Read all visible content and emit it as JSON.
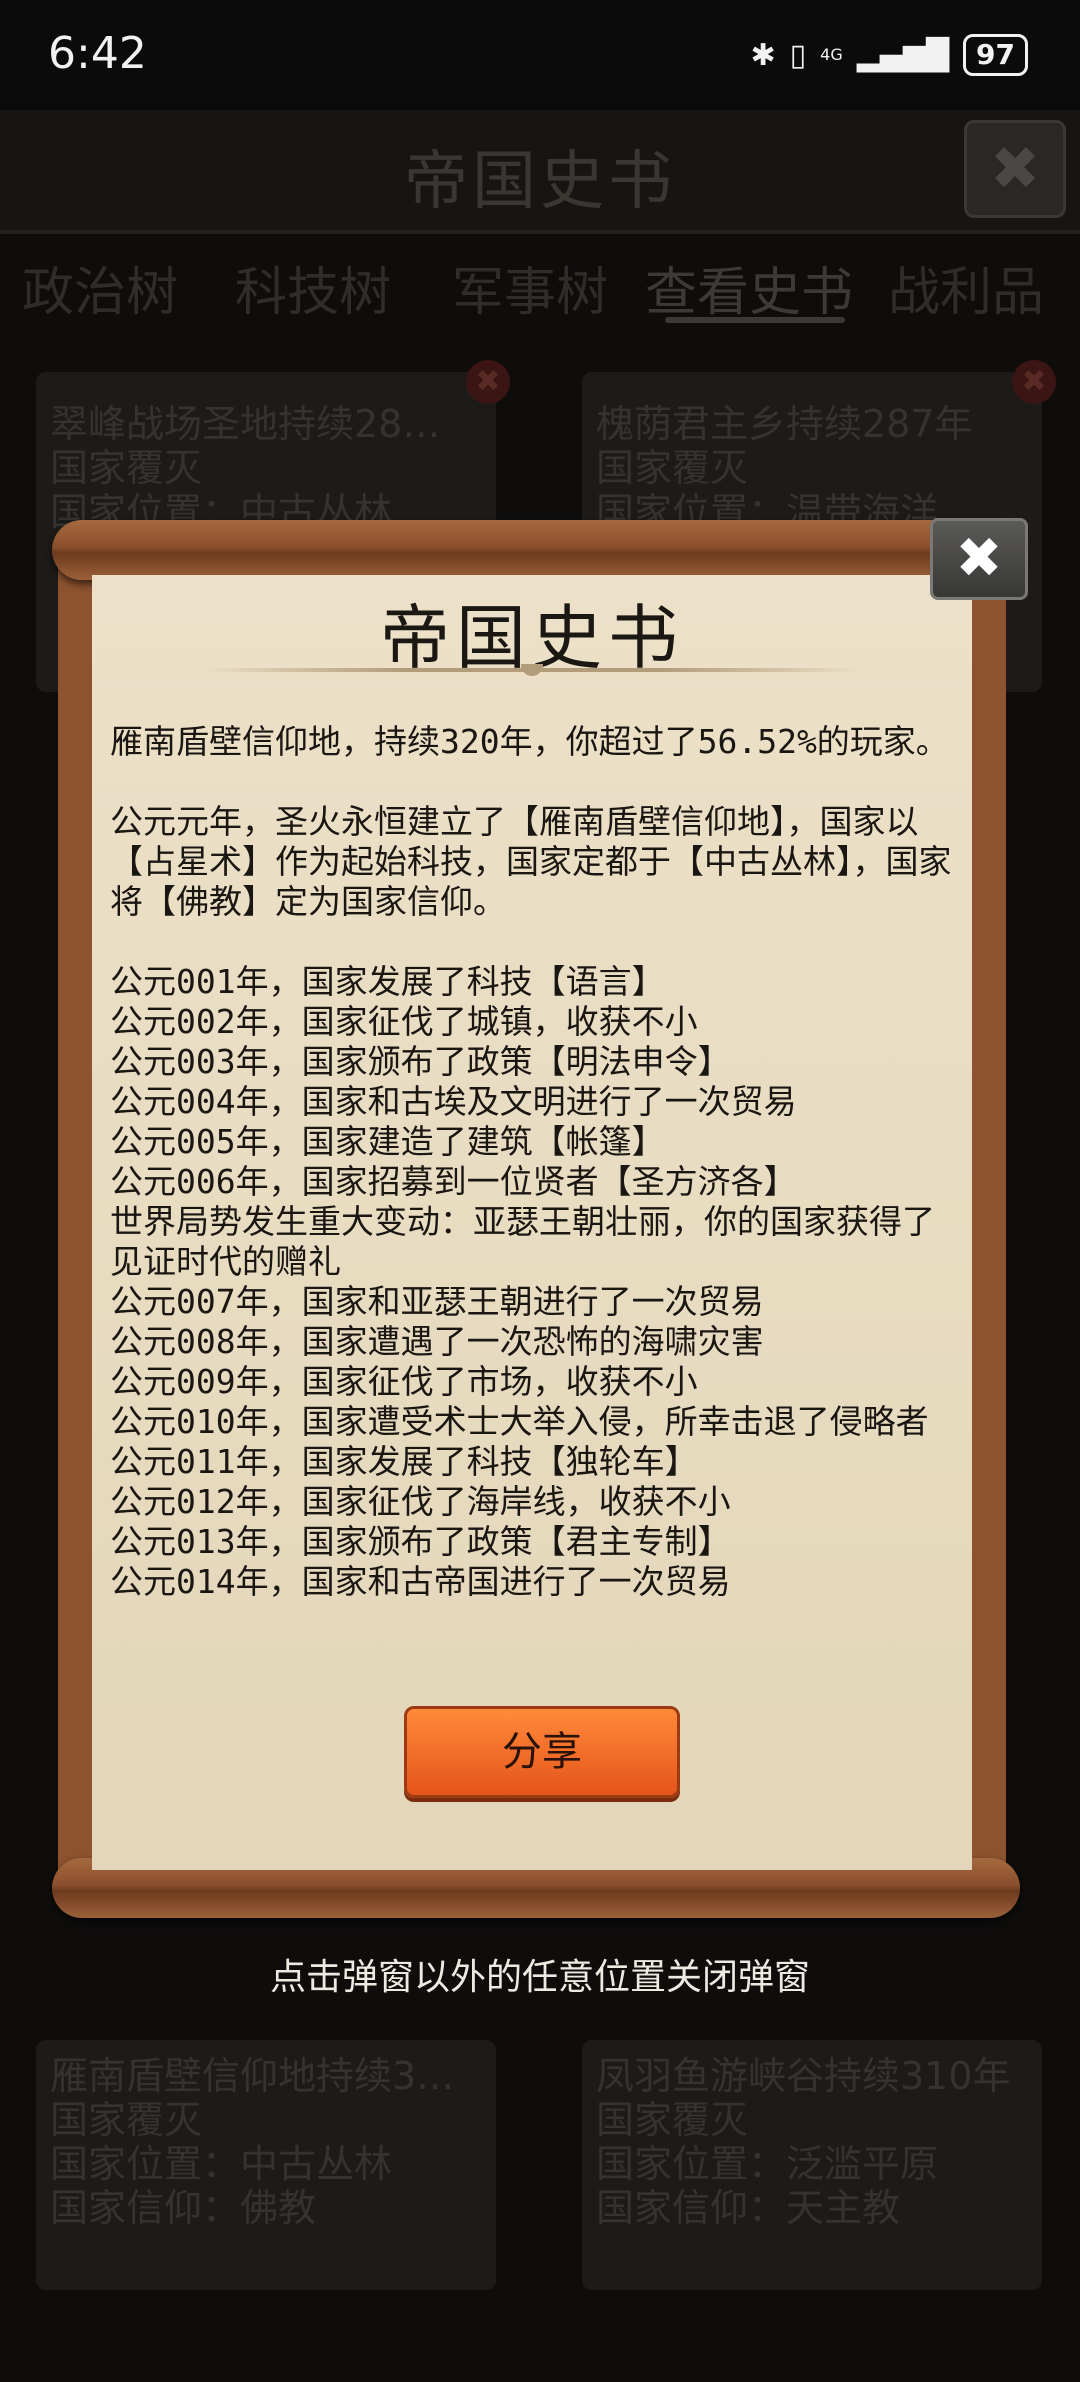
{
  "status_bar": {
    "time": "6:42",
    "network": "4G",
    "battery": "97"
  },
  "page": {
    "title": "帝国史书",
    "tabs": [
      "政治树",
      "科技树",
      "军事树",
      "查看史书",
      "战利品"
    ],
    "cards": [
      {
        "lines": [
          "翠峰战场圣地持续28…",
          "国家覆灭",
          "国家位置：中古丛林"
        ]
      },
      {
        "lines": [
          "槐荫君主乡持续287年",
          "国家覆灭",
          "国家位置：温带海洋"
        ]
      },
      {
        "lines": [
          "雁南盾壁信仰地持续3…",
          "国家覆灭",
          "国家位置：中古丛林",
          "国家信仰：佛教"
        ]
      },
      {
        "lines": [
          "凤羽鱼游峡谷持续310年",
          "国家覆灭",
          "国家位置：泛滥平原",
          "国家信仰：天主教"
        ]
      }
    ]
  },
  "modal": {
    "title": "帝国史书",
    "close_label": "✖",
    "paragraphs": [
      "雁南盾壁信仰地，持续320年，你超过了56.52%的玩家。",
      "",
      "公元元年，圣火永恒建立了【雁南盾壁信仰地】，国家以【占星术】作为起始科技，国家定都于【中古丛林】，国家将【佛教】定为国家信仰。",
      "",
      "公元001年，国家发展了科技【语言】",
      "公元002年，国家征伐了城镇，收获不小",
      "公元003年，国家颁布了政策【明法申令】",
      "公元004年，国家和古埃及文明进行了一次贸易",
      "公元005年，国家建造了建筑【帐篷】",
      "公元006年，国家招募到一位贤者【圣方济各】",
      "世界局势发生重大变动：亚瑟王朝壮丽，你的国家获得了见证时代的赠礼",
      "公元007年，国家和亚瑟王朝进行了一次贸易",
      "公元008年，国家遭遇了一次恐怖的海啸灾害",
      "公元009年，国家征伐了市场，收获不小",
      "公元010年，国家遭受术士大举入侵，所幸击退了侵略者",
      "公元011年，国家发展了科技【独轮车】",
      "公元012年，国家征伐了海岸线，收获不小",
      "公元013年，国家颁布了政策【君主专制】",
      "公元014年，国家和古帝国进行了一次贸易"
    ],
    "share_label": "分享"
  },
  "hint": "点击弹窗以外的任意位置关闭弹窗"
}
